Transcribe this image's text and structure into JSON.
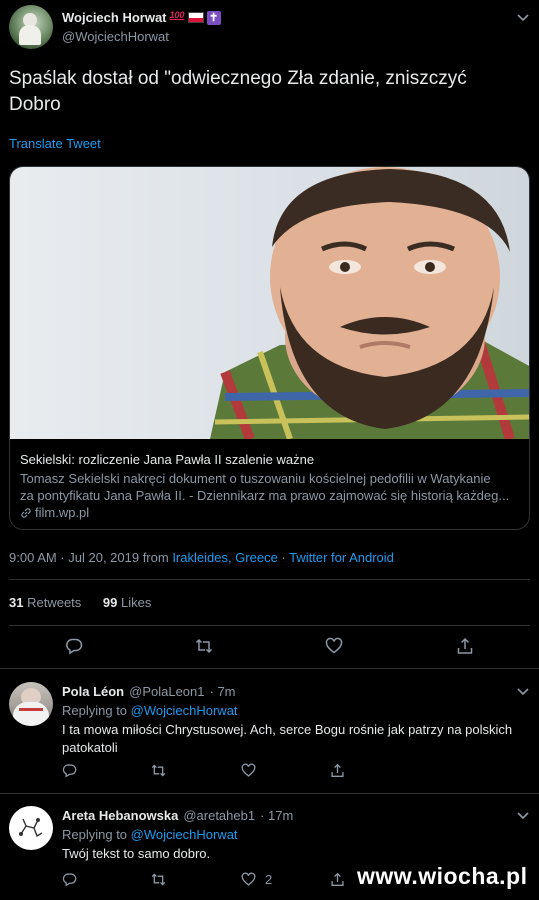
{
  "main_tweet": {
    "author_name": "Wojciech Horwat",
    "author_handle": "@WojciechHorwat",
    "badge_100": "100",
    "text_line1": "Spaślak dostał od \"odwiecznego Zła zdanie, zniszczyć",
    "text_line2": "Dobro",
    "translate": "Translate Tweet",
    "card": {
      "title": "Sekielski: rozliczenie Jana Pawła II szalenie ważne",
      "desc_line1": "Tomasz Sekielski nakręci dokument o tuszowaniu kościelnej pedofilii w Watykanie",
      "desc_line2": "za pontyfikatu Jana Pawła II. - Dziennikarz ma prawo zajmować się historią każdeg...",
      "domain": "film.wp.pl"
    },
    "meta_time": "9:00 AM · Jul 20, 2019 from ",
    "meta_location": "Irakleides, Greece",
    "meta_sep": " · ",
    "meta_source": "Twitter for Android",
    "retweets_count": "31",
    "retweets_label": "Retweets",
    "likes_count": "99",
    "likes_label": "Likes"
  },
  "replies": [
    {
      "name": "Pola Léon",
      "handle": "@PolaLeon1",
      "time": "· 7m",
      "replying_label": "Replying to ",
      "replying_to": "@WojciechHorwat",
      "text_line1": "I ta mowa miłości Chrystusowej. Ach, serce Bogu rośnie jak patrzy na polskich",
      "text_line2": "patokatoli",
      "like_count": ""
    },
    {
      "name": "Areta Hebanowska",
      "handle": "@aretaheb1",
      "time": "· 17m",
      "replying_label": "Replying to ",
      "replying_to": "@WojciechHorwat",
      "text_line1": "Twój tekst to samo dobro.",
      "text_line2": "",
      "like_count": "2"
    }
  ],
  "watermark": "www.wiocha.pl",
  "colors": {
    "background": "#000000",
    "link": "#1d9bf0",
    "muted": "#8b98a5",
    "divider": "#2f3336"
  }
}
